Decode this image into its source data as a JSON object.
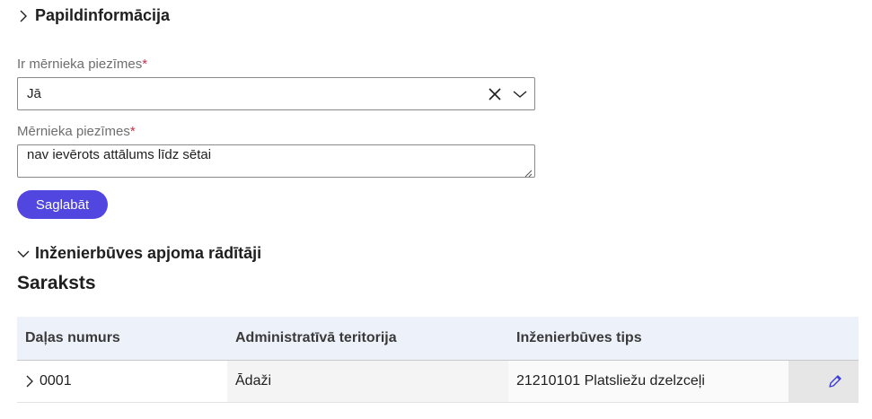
{
  "sections": {
    "parcel_info": {
      "label": "Papildinformācija",
      "icon": "chevron-right-icon"
    },
    "engineering": {
      "label": "Inženierbūves apjoma rādītāji",
      "icon": "chevron-down-icon"
    }
  },
  "form": {
    "surveyor_notes_flag": {
      "label": "Ir mērnieka piezīmes",
      "required_mark": "*",
      "value": "Jā"
    },
    "surveyor_notes": {
      "label": "Mērnieka piezīmes",
      "required_mark": "*",
      "value": "nav ievērots attālums līdz sētai"
    },
    "save_label": "Saglabāt"
  },
  "list": {
    "title": "Saraksts",
    "columns": [
      "Daļas numurs",
      "Administratīvā teritorija",
      "Inženierbūves tips"
    ],
    "rows": [
      {
        "part_number": "0001",
        "territory": "Ādaži",
        "type": "21210101 Platsliežu dzelzceļi"
      }
    ]
  },
  "colors": {
    "accent": "#5146e0",
    "header_bg": "#edf2fa",
    "required": "#c4314b"
  }
}
